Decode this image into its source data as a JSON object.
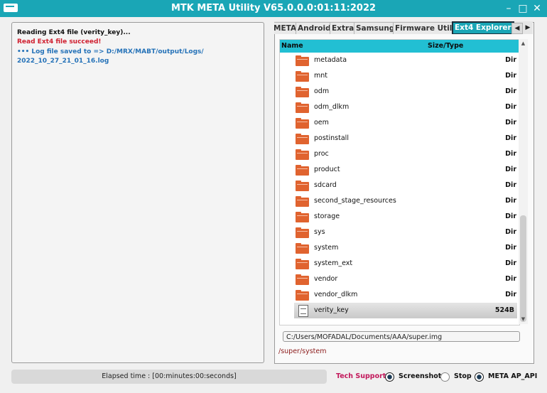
{
  "window": {
    "title": "MTK META Utility V65.0.0.0:01:11:2022",
    "controls": [
      "–",
      "□",
      "✕"
    ]
  },
  "log": [
    {
      "text": "Reading Ext4 file (verity_key)...",
      "color": "#111111"
    },
    {
      "text": "Read Ext4 file succeed!",
      "color": "#d01f2f"
    },
    {
      "text": "••• Log file saved to => D:/MRX/MABT/output/Logs/",
      "color": "#2572b8"
    },
    {
      "text": "2022_10_27_21_01_16.log",
      "color": "#2572b8"
    }
  ],
  "tabs": [
    {
      "label": "META"
    },
    {
      "label": "Android"
    },
    {
      "label": "Extra"
    },
    {
      "label": "Samsung"
    },
    {
      "label": "Firmware Utils"
    },
    {
      "label": "Ext4 Explorer"
    }
  ],
  "tab_scroll": {
    "left": "◀",
    "right": "▶"
  },
  "file_list": {
    "columns": {
      "name": "Name",
      "size": "Size/Type"
    },
    "rows": [
      {
        "name": "metadata",
        "size": "Dir",
        "icon": "folder-icon"
      },
      {
        "name": "mnt",
        "size": "Dir",
        "icon": "folder-icon"
      },
      {
        "name": "odm",
        "size": "Dir",
        "icon": "folder-icon"
      },
      {
        "name": "odm_dlkm",
        "size": "Dir",
        "icon": "folder-icon"
      },
      {
        "name": "oem",
        "size": "Dir",
        "icon": "folder-icon"
      },
      {
        "name": "postinstall",
        "size": "Dir",
        "icon": "folder-icon"
      },
      {
        "name": "proc",
        "size": "Dir",
        "icon": "folder-icon"
      },
      {
        "name": "product",
        "size": "Dir",
        "icon": "folder-icon"
      },
      {
        "name": "sdcard",
        "size": "Dir",
        "icon": "folder-icon"
      },
      {
        "name": "second_stage_resources",
        "size": "Dir",
        "icon": "folder-icon"
      },
      {
        "name": "storage",
        "size": "Dir",
        "icon": "folder-icon"
      },
      {
        "name": "sys",
        "size": "Dir",
        "icon": "folder-icon"
      },
      {
        "name": "system",
        "size": "Dir",
        "icon": "folder-icon"
      },
      {
        "name": "system_ext",
        "size": "Dir",
        "icon": "folder-icon"
      },
      {
        "name": "vendor",
        "size": "Dir",
        "icon": "folder-icon"
      },
      {
        "name": "vendor_dlkm",
        "size": "Dir",
        "icon": "folder-icon"
      },
      {
        "name": "verity_key",
        "size": "524B",
        "icon": "file-icon",
        "selected": true
      }
    ]
  },
  "image_path": "C:/Users/MOFADAL/Documents/AAA/super.img",
  "current_path": "/super/system",
  "status": {
    "elapsed": "Elapsed time : [00:minutes:00:seconds]",
    "tech_support": "Tech Support",
    "options": [
      {
        "label": "Screenshot",
        "checked": true
      },
      {
        "label": "Stop",
        "checked": false
      },
      {
        "label": "META AP_API",
        "checked": true
      }
    ]
  },
  "colors": {
    "accent": "#1aa6b6",
    "header": "#22bfd3",
    "error": "#d01f2f",
    "info": "#2572b8"
  }
}
